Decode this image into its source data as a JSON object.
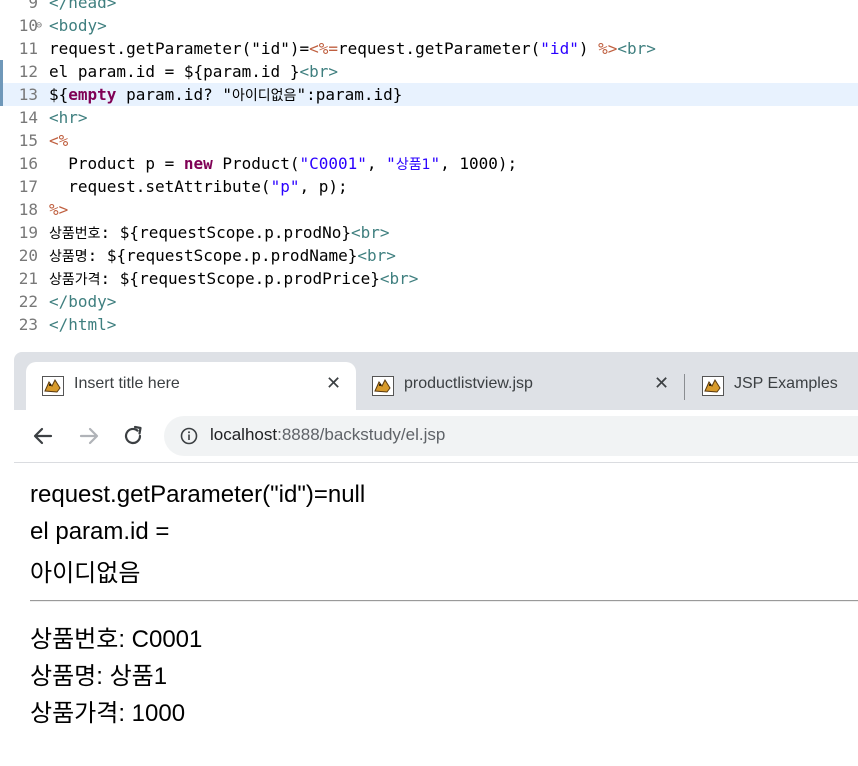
{
  "editor": {
    "lines": [
      {
        "num": "9",
        "segments": [
          {
            "t": "</head>",
            "c": "tag"
          }
        ]
      },
      {
        "num": "10",
        "segments": [
          {
            "t": "<body>",
            "c": "tag"
          }
        ]
      },
      {
        "num": "11",
        "segments": [
          {
            "t": "request.getParameter(",
            "c": "el"
          },
          {
            "t": "\"id\"",
            "c": "el"
          },
          {
            "t": ")=",
            "c": "el"
          },
          {
            "t": "<%=",
            "c": "jsp"
          },
          {
            "t": "request.getParameter(",
            "c": "el"
          },
          {
            "t": "\"id\"",
            "c": "str"
          },
          {
            "t": ") ",
            "c": "el"
          },
          {
            "t": "%>",
            "c": "jsp"
          },
          {
            "t": "<br>",
            "c": "tag"
          }
        ]
      },
      {
        "num": "12",
        "segments": [
          {
            "t": "el param.id = ${param.id }",
            "c": "el"
          },
          {
            "t": "<br>",
            "c": "tag"
          }
        ]
      },
      {
        "num": "13",
        "segments": [
          {
            "t": "${",
            "c": "el"
          },
          {
            "t": "empty",
            "c": "kw"
          },
          {
            "t": " param.id? \"",
            "c": "el"
          },
          {
            "t": "아이디없음",
            "c": "el ko"
          },
          {
            "t": "\":param.id}",
            "c": "el"
          }
        ]
      },
      {
        "num": "14",
        "segments": [
          {
            "t": "<hr>",
            "c": "tag"
          }
        ]
      },
      {
        "num": "15",
        "segments": [
          {
            "t": "<%",
            "c": "jsp"
          }
        ]
      },
      {
        "num": "16",
        "segments": [
          {
            "t": "  Product p = ",
            "c": "el"
          },
          {
            "t": "new",
            "c": "kw"
          },
          {
            "t": " Product(",
            "c": "el"
          },
          {
            "t": "\"C0001\"",
            "c": "str"
          },
          {
            "t": ", ",
            "c": "el"
          },
          {
            "t": "\"",
            "c": "str"
          },
          {
            "t": "상품1",
            "c": "str ko"
          },
          {
            "t": "\"",
            "c": "str"
          },
          {
            "t": ", 1000);",
            "c": "el"
          }
        ]
      },
      {
        "num": "17",
        "segments": [
          {
            "t": "  request.setAttribute(",
            "c": "el"
          },
          {
            "t": "\"p\"",
            "c": "str"
          },
          {
            "t": ", p);",
            "c": "el"
          }
        ]
      },
      {
        "num": "18",
        "segments": [
          {
            "t": "%>",
            "c": "jsp"
          }
        ]
      },
      {
        "num": "19",
        "segments": [
          {
            "t": "상품번호",
            "c": "el ko"
          },
          {
            "t": ": ${requestScope.p.prodNo}",
            "c": "el"
          },
          {
            "t": "<br>",
            "c": "tag"
          }
        ]
      },
      {
        "num": "20",
        "segments": [
          {
            "t": "상품명",
            "c": "el ko"
          },
          {
            "t": ": ${requestScope.p.prodName}",
            "c": "el"
          },
          {
            "t": "<br>",
            "c": "tag"
          }
        ]
      },
      {
        "num": "21",
        "segments": [
          {
            "t": "상품가격",
            "c": "el ko"
          },
          {
            "t": ": ${requestScope.p.prodPrice}",
            "c": "el"
          },
          {
            "t": "<br>",
            "c": "tag"
          }
        ]
      },
      {
        "num": "22",
        "segments": [
          {
            "t": "</body>",
            "c": "tag"
          }
        ]
      },
      {
        "num": "23",
        "segments": [
          {
            "t": "</html>",
            "c": "tag"
          }
        ]
      }
    ],
    "fold_marker": "⊖"
  },
  "browser": {
    "tabs": [
      {
        "title": "Insert title here",
        "close": "✕"
      },
      {
        "title": "productlistview.jsp",
        "close": "✕"
      },
      {
        "title": "JSP Examples"
      }
    ],
    "url_host": "localhost",
    "url_path": ":8888/backstudy/el.jsp",
    "page": {
      "line1": "request.getParameter(\"id\")=null",
      "line2": "el param.id =",
      "line3": "아이디없음",
      "line4": "상품번호: C0001",
      "line5": "상품명: 상품1",
      "line6": "상품가격: 1000"
    }
  },
  "colors": {
    "tag": "#3f7f7f",
    "string": "#2a00ff",
    "keyword": "#7f0055",
    "jsp_delim": "#bf5f3f",
    "current_line": "#e8f2fe",
    "tabstrip": "#dee1e6"
  }
}
